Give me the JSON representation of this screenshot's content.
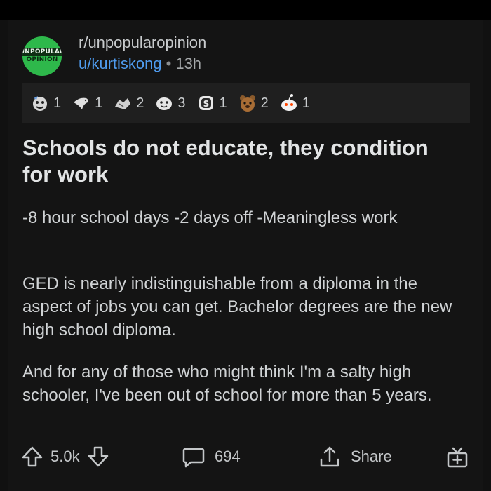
{
  "post": {
    "subreddit": "r/unpopularopinion",
    "user": "u/kurtiskong",
    "separator": "•",
    "age": "13h",
    "avatar_line1": "UNPOPULAR",
    "avatar_line2": "OPINION",
    "title": "Schools do not educate, they condition for work",
    "paragraphs": [
      "-8 hour school days -2 days off -Meaningless work",
      "GED is nearly indistinguishable from a diploma in the aspect of jobs you can get. Bachelor degrees are the new high school diploma.",
      "And for any of those who might think I'm a salty high schooler, I've been out of school for more than 5 years."
    ]
  },
  "awards": [
    {
      "icon": "face-award-icon",
      "count": "1"
    },
    {
      "icon": "dove-award-icon",
      "count": "1"
    },
    {
      "icon": "handshake-award-icon",
      "count": "2"
    },
    {
      "icon": "blob-face-award-icon",
      "count": "3"
    },
    {
      "icon": "silver-coin-award-icon",
      "count": "1"
    },
    {
      "icon": "bear-award-icon",
      "count": "2"
    },
    {
      "icon": "snoo-award-icon",
      "count": "1"
    }
  ],
  "actions": {
    "score": "5.0k",
    "comments": "694",
    "share_label": "Share"
  },
  "colors": {
    "background": "#111111",
    "card": "#141414",
    "link": "#4f9cf0",
    "avatar": "#2eb84b"
  }
}
